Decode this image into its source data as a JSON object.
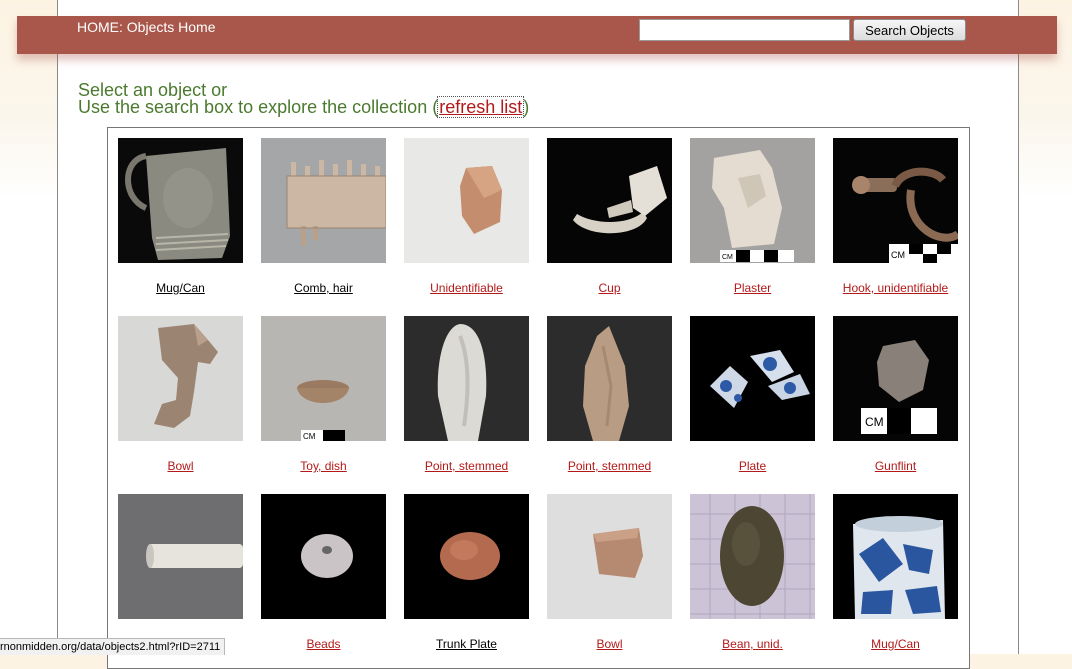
{
  "header": {
    "home_label": "HOME: Objects Home",
    "search_value": "",
    "search_button": "Search Objects"
  },
  "intro": {
    "line1": "Select an object or",
    "line2_prefix": "Use the search box to explore the collection (",
    "refresh_label": "refresh list",
    "line2_suffix": ")"
  },
  "objects": [
    {
      "label": "Mug/Can",
      "link_color": "black",
      "icon": "stoneware-mug-photo"
    },
    {
      "label": "Comb, hair",
      "link_color": "black",
      "icon": "bone-comb-photo"
    },
    {
      "label": "Unidentifiable",
      "link_color": "red",
      "icon": "ceramic-sherd-photo"
    },
    {
      "label": "Cup",
      "link_color": "red",
      "icon": "porcelain-cup-photo"
    },
    {
      "label": "Plaster",
      "link_color": "red",
      "icon": "plaster-fragment-photo"
    },
    {
      "label": "Hook, unidentifiable",
      "link_color": "red",
      "icon": "metal-hook-photo"
    },
    {
      "label": "Bowl",
      "link_color": "red",
      "icon": "bowl-fragment-photo"
    },
    {
      "label": "Toy, dish",
      "link_color": "red",
      "icon": "toy-dish-photo"
    },
    {
      "label": "Point, stemmed",
      "link_color": "red",
      "icon": "quartz-point-photo"
    },
    {
      "label": "Point, stemmed",
      "link_color": "red",
      "icon": "stone-point-photo"
    },
    {
      "label": "Plate",
      "link_color": "red",
      "icon": "blue-plate-sherds-photo"
    },
    {
      "label": "Gunflint",
      "link_color": "red",
      "icon": "gunflint-photo"
    },
    {
      "label": "",
      "link_color": "red",
      "icon": "clay-pipe-stem-photo"
    },
    {
      "label": "Beads",
      "link_color": "red",
      "icon": "bead-photo"
    },
    {
      "label": "Trunk Plate",
      "link_color": "black",
      "icon": "copper-plate-photo"
    },
    {
      "label": "Bowl",
      "link_color": "red",
      "icon": "bowl-sherd-photo"
    },
    {
      "label": "Bean, unid.",
      "link_color": "red",
      "icon": "bean-photo"
    },
    {
      "label": "Mug/Can",
      "link_color": "red",
      "icon": "blue-white-mug-photo"
    }
  ],
  "scale_bar_label": "CM",
  "status_bar": "rnonmidden.org/data/objects2.html?rID=2711",
  "colors": {
    "header_bar": "#a9574b",
    "intro_text": "#4a7a2e",
    "link_red": "#b21a1a",
    "top_line": "#5c7a3a"
  }
}
